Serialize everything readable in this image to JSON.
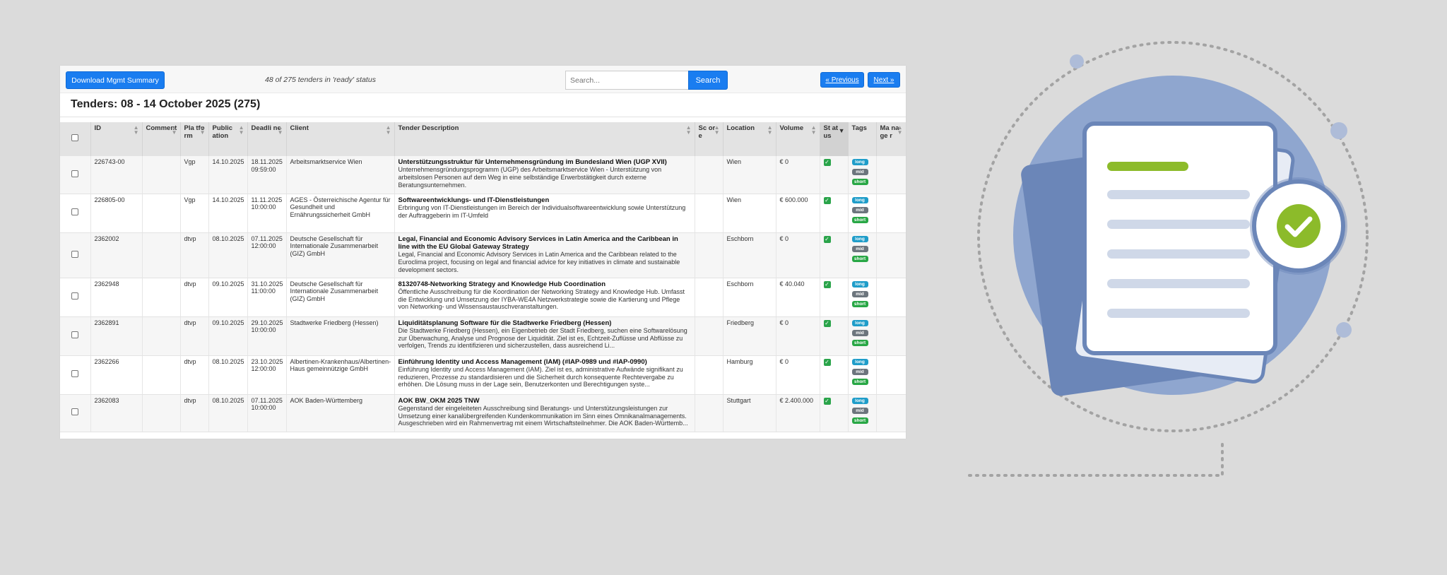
{
  "toolbar": {
    "download_label": "Download Mgmt Summary",
    "count_text": "48 of 275 tenders in 'ready' status",
    "search_placeholder": "Search...",
    "search_label": "Search",
    "prev_label": "« Previous",
    "next_label": "Next »"
  },
  "page_title": "Tenders: 08 - 14 October 2025 (275)",
  "table": {
    "columns": [
      {
        "key": "select",
        "label": ""
      },
      {
        "key": "id",
        "label": "ID"
      },
      {
        "key": "comment",
        "label": "Comment"
      },
      {
        "key": "platform",
        "label": "Pla tfo rm"
      },
      {
        "key": "publication",
        "label": "Public ation"
      },
      {
        "key": "deadline",
        "label": "Deadli ne"
      },
      {
        "key": "client",
        "label": "Client"
      },
      {
        "key": "description",
        "label": "Tender Description"
      },
      {
        "key": "score",
        "label": "Sc or e"
      },
      {
        "key": "location",
        "label": "Location"
      },
      {
        "key": "volume",
        "label": "Volume"
      },
      {
        "key": "status",
        "label": "St at us"
      },
      {
        "key": "tags",
        "label": "Tags"
      },
      {
        "key": "manager",
        "label": "Ma na ge r"
      }
    ],
    "rows": [
      {
        "id": "226743-00",
        "comment": "",
        "platform": "Vgp",
        "publication": "14.10.2025",
        "deadline": "18.11.2025 09:59:00",
        "client": "Arbeitsmarktservice Wien",
        "title": "Unterstützungsstruktur für Unternehmensgründung im Bundesland Wien (UGP XVII)",
        "body": "Unternehmensgründungsprogramm (UGP) des Arbeitsmarktservice Wien - Unterstützung von arbeitslosen Personen auf dem Weg in eine selbständige Erwerbstätigkeit durch externe Beratungsunternehmen.",
        "score": "",
        "location": "Wien",
        "volume": "€ 0",
        "status": "✓",
        "tags": [
          "long",
          "mid",
          "short"
        ],
        "manager": ""
      },
      {
        "id": "226805-00",
        "comment": "",
        "platform": "Vgp",
        "publication": "14.10.2025",
        "deadline": "11.11.2025 10:00:00",
        "client": "AGES - Österreichische Agentur für Gesundheit und Ernährungssicherheit GmbH",
        "title": "Softwareentwicklungs- und IT-Dienstleistungen",
        "body": "Erbringung von IT-Dienstleistungen im Bereich der Individualsoftwareentwicklung sowie Unterstützung der Auftraggeberin im IT-Umfeld",
        "score": "",
        "location": "Wien",
        "volume": "€ 600.000",
        "status": "✓",
        "tags": [
          "long",
          "mid",
          "short"
        ],
        "manager": ""
      },
      {
        "id": "2362002",
        "comment": "",
        "platform": "dtvp",
        "publication": "08.10.2025",
        "deadline": "07.11.2025 12:00:00",
        "client": "Deutsche Gesellschaft für Internationale Zusammenarbeit (GIZ) GmbH",
        "title": "Legal, Financial and Economic Advisory Services in Latin America and the Caribbean in line with the EU Global Gateway Strategy",
        "body": "Legal, Financial and Economic Advisory Services in Latin America and the Caribbean related to the Euroclima project, focusing on legal and financial advice for key initiatives in climate and sustainable development sectors.",
        "score": "",
        "location": "Eschborn",
        "volume": "€ 0",
        "status": "✓",
        "tags": [
          "long",
          "mid",
          "short"
        ],
        "manager": ""
      },
      {
        "id": "2362948",
        "comment": "",
        "platform": "dtvp",
        "publication": "09.10.2025",
        "deadline": "31.10.2025 11:00:00",
        "client": "Deutsche Gesellschaft für Internationale Zusammenarbeit (GIZ) GmbH",
        "title": "81320748-Networking Strategy and Knowledge Hub Coordination",
        "body": "Öffentliche Ausschreibung für die Koordination der Networking Strategy and Knowledge Hub. Umfasst die Entwicklung und Umsetzung der IYBA-WE4A Netzwerkstrategie sowie die Kartierung und Pflege von Networking- und Wissensaustauschveranstaltungen.",
        "score": "",
        "location": "Eschborn",
        "volume": "€ 40.040",
        "status": "✓",
        "tags": [
          "long",
          "mid",
          "short"
        ],
        "manager": ""
      },
      {
        "id": "2362891",
        "comment": "",
        "platform": "dtvp",
        "publication": "09.10.2025",
        "deadline": "29.10.2025 10:00:00",
        "client": "Stadtwerke Friedberg (Hessen)",
        "title": "Liquiditätsplanung Software für die Stadtwerke Friedberg (Hessen)",
        "body": "Die Stadtwerke Friedberg (Hessen), ein Eigenbetrieb der Stadt Friedberg, suchen eine Softwarelösung zur Überwachung, Analyse und Prognose der Liquidität. Ziel ist es, Echtzeit-Zuflüsse und Abflüsse zu verfolgen, Trends zu identifizieren und sicherzustellen, dass ausreichend Li...",
        "score": "",
        "location": "Friedberg",
        "volume": "€ 0",
        "status": "✓",
        "tags": [
          "long",
          "mid",
          "short"
        ],
        "manager": ""
      },
      {
        "id": "2362266",
        "comment": "",
        "platform": "dtvp",
        "publication": "08.10.2025",
        "deadline": "23.10.2025 12:00:00",
        "client": "Albertinen-Krankenhaus/Albertinen-Haus gemeinnützige GmbH",
        "title": "Einführung Identity und Access Management (IAM) (#IAP-0989 und #IAP-0990)",
        "body": "Einführung Identity und Access Management (IAM). Ziel ist es, administrative Aufwände signifikant zu reduzieren, Prozesse zu standardisieren und die Sicherheit durch konsequente Rechtevergabe zu erhöhen. Die Lösung muss in der Lage sein, Benutzerkonten und Berechtigungen syste...",
        "score": "",
        "location": "Hamburg",
        "volume": "€ 0",
        "status": "✓",
        "tags": [
          "long",
          "mid",
          "short"
        ],
        "manager": ""
      },
      {
        "id": "2362083",
        "comment": "",
        "platform": "dtvp",
        "publication": "08.10.2025",
        "deadline": "07.11.2025 10:00:00",
        "client": "AOK Baden-Württemberg",
        "title": "AOK BW_OKM 2025 TNW",
        "body": "Gegenstand der eingeleiteten Ausschreibung sind Beratungs- und Unterstützungsleistungen zur Umsetzung einer kanalübergreifenden Kundenkommunikation im Sinn eines Omnikanalmanagements. Ausgeschrieben wird ein Rahmenvertrag mit einem Wirtschaftsteilnehmer. Die AOK Baden-Württemb...",
        "score": "",
        "location": "Stuttgart",
        "volume": "€ 2.400.000",
        "status": "✓",
        "tags": [
          "long",
          "mid",
          "short"
        ],
        "manager": ""
      }
    ]
  },
  "tag_colors": {
    "long": "#1f9dc9",
    "mid": "#6c757d",
    "short": "#28a745"
  },
  "illustration": {
    "circle_color": "#8fa6cf",
    "doc_color": "#ffffff",
    "doc_border": "#6b86b8",
    "accent_green": "#8cbb2a",
    "line_color": "#cfd8e8",
    "check_icon": "check-circle-icon"
  }
}
